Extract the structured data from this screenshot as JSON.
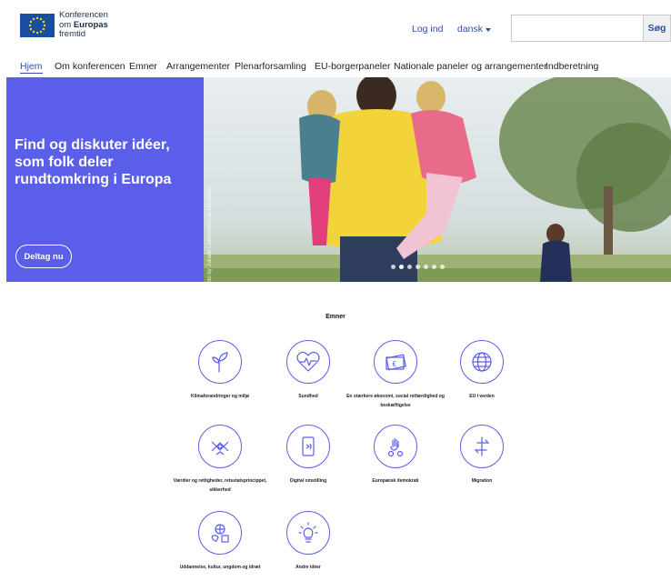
{
  "header": {
    "logo": {
      "line1": "Konferencen",
      "line2_prefix": "om ",
      "line2_bold": "Europas",
      "line3": "fremtid"
    },
    "login_label": "Log ind",
    "language": "dansk",
    "search": {
      "placeholder": "",
      "button_label": "Søg"
    }
  },
  "nav": {
    "items": [
      {
        "label": "Hjem",
        "active": true
      },
      {
        "label": "Om konferencen"
      },
      {
        "label": "Emner"
      },
      {
        "label": "Arrangementer"
      },
      {
        "label": "Plenarforsamling"
      },
      {
        "label": "EU-borgerpaneler"
      },
      {
        "label": "Nationale paneler og arrangementer"
      },
      {
        "label": "Indberetning"
      }
    ]
  },
  "hero": {
    "title": "Find og diskuter idéer, som folk deler rundtomkring i Europa",
    "button_label": "Deltag nu",
    "photo_credit": "© Photo by Juliane Liebermann on Unsplash",
    "slide_count": 7,
    "active_slide": 1
  },
  "topics": {
    "title": "Emner",
    "items": [
      {
        "label": "Klimaforandringer og miljø",
        "icon": "sprout-icon"
      },
      {
        "label": "Sundhed",
        "icon": "heart-pulse-icon"
      },
      {
        "label": "En stærkere økonomi, social retfærdighed og beskæftigelse",
        "icon": "euro-banknote-icon"
      },
      {
        "label": "EU i verden",
        "icon": "globe-icon"
      },
      {
        "label": "Værdier og rettigheder, retsstatsprincippet, sikkerhed",
        "icon": "joined-hands-icon"
      },
      {
        "label": "Digital omstilling",
        "icon": "smartphone-icon"
      },
      {
        "label": "Europæisk demokrati",
        "icon": "raised-hand-icon"
      },
      {
        "label": "Migration",
        "icon": "exchange-arrows-icon"
      },
      {
        "label": "Uddannelse, kultur, ungdom og idræt",
        "icon": "education-icon"
      },
      {
        "label": "Andre idéer",
        "icon": "lightbulb-icon"
      }
    ]
  },
  "colors": {
    "accent": "#5a5ee8",
    "link": "#2e4fa3",
    "eu_blue": "#1a4ea0",
    "eu_star": "#f5d90a"
  }
}
